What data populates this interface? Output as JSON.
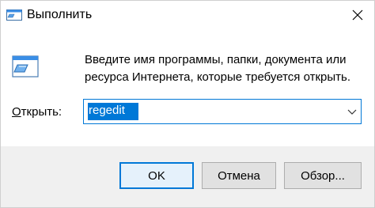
{
  "window": {
    "title": "Выполнить",
    "app_icon": "run-dialog-icon",
    "close_icon": "close-icon"
  },
  "content": {
    "icon": "run-app-icon",
    "description": "Введите имя программы, папки, документа или ресурса Интернета, которые требуется открыть.",
    "open_label_underlined": "О",
    "open_label_rest": "ткрыть:",
    "input_value": "regedit",
    "dropdown_icon": "chevron-down-icon"
  },
  "buttons": {
    "ok": "OK",
    "cancel": "Отмена",
    "browse": "Обзор..."
  },
  "colors": {
    "accent": "#0078d7",
    "panel": "#f0f0f0",
    "content_bg": "#ffffff"
  }
}
